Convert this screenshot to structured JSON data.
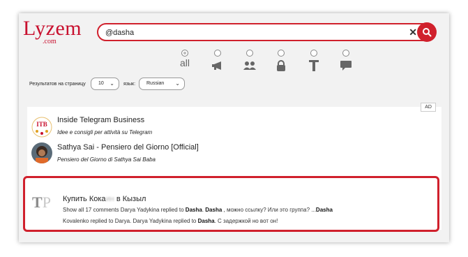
{
  "logo": {
    "brand": "Lyzem",
    "domain": ".com"
  },
  "search": {
    "value": "@dasha",
    "clear_icon": "close-icon",
    "submit_icon": "search-icon"
  },
  "filters": {
    "all_label": "all",
    "items": [
      {
        "name": "all",
        "icon": "all",
        "checked": true
      },
      {
        "name": "channels",
        "icon": "megaphone-icon",
        "checked": false
      },
      {
        "name": "groups",
        "icon": "people-icon",
        "checked": false
      },
      {
        "name": "private",
        "icon": "lock-icon",
        "checked": false
      },
      {
        "name": "text",
        "icon": "text-icon",
        "checked": false
      },
      {
        "name": "messages",
        "icon": "chat-bubble-icon",
        "checked": false
      }
    ]
  },
  "options": {
    "per_page_label": "Результатов на страницу",
    "per_page_value": "10",
    "lang_label": "язык:",
    "lang_value": "Russian"
  },
  "results": {
    "ad_badge": "AD",
    "items": [
      {
        "title": "Inside Telegram Business",
        "desc": "Idee e consigli per attività su Telegram",
        "avatar_text": "ITB"
      },
      {
        "title": "Sathya Sai - Pensiero del Giorno [Official]",
        "desc": "Pensiero del Giorno di Sathya Sai Baba"
      }
    ],
    "highlighted": {
      "logo_t": "T",
      "logo_p": "P",
      "title_prefix": "Купить Кока",
      "title_blur": "ин",
      "title_suffix": " в Кызыл",
      "line1_pre": "Show all 17 comments Darya Yadykina replied to ",
      "line1_b1": "Dasha",
      "line1_sep": ". ",
      "line1_b2": "Dasha",
      "line1_mid": " , можно ссылку? Или это группа? ...",
      "line1_b3": "Dasha",
      "line2_pre": "Kovalenko replied to Darya. Darya Yadykina replied to ",
      "line2_b1": "Dasha",
      "line2_post": ". С задержкой но вот он!"
    }
  }
}
